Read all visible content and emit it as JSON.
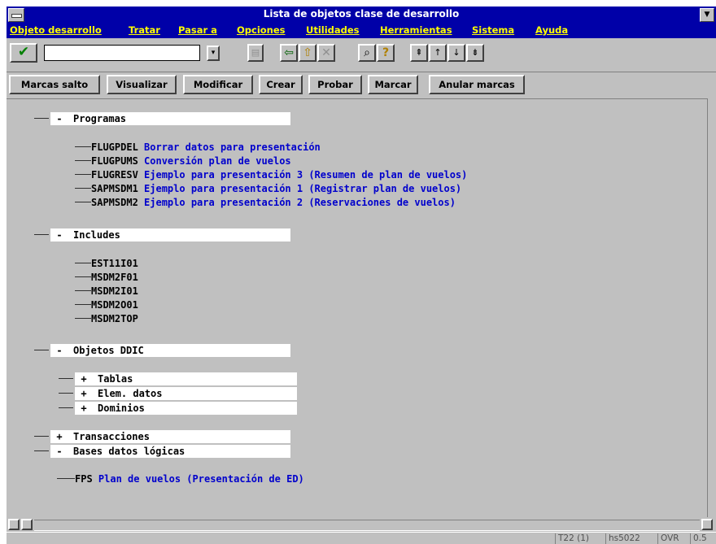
{
  "window": {
    "title": "Lista de objetos clase de desarrollo"
  },
  "menu": [
    "Objeto desarrollo",
    "Tratar",
    "Pasar a",
    "Opciones",
    "Utilidades",
    "Herramientas",
    "Sistema",
    "Ayuda"
  ],
  "toolbar": {
    "command_value": ""
  },
  "app_buttons": [
    "Marcas salto",
    "Visualizar",
    "Modificar",
    "Crear",
    "Probar",
    "Marcar",
    "Anular marcas"
  ],
  "tree": {
    "programas": {
      "label": "Programas",
      "sign": "-",
      "items": [
        {
          "name": "FLUGPDEL",
          "desc": "Borrar datos para presentación"
        },
        {
          "name": "FLUGPUMS",
          "desc": "Conversión plan de vuelos"
        },
        {
          "name": "FLUGRESV",
          "desc": "Ejemplo para presentación 3 (Resumen de plan de vuelos)"
        },
        {
          "name": "SAPMSDM1",
          "desc": "Ejemplo para presentación 1 (Registrar plan de vuelos)"
        },
        {
          "name": "SAPMSDM2",
          "desc": "Ejemplo para presentación 2 (Reservaciones de vuelos)"
        }
      ]
    },
    "includes": {
      "label": "Includes",
      "sign": "-",
      "items": [
        "EST11I01",
        "MSDM2F01",
        "MSDM2I01",
        "MSDM2O01",
        "MSDM2TOP"
      ]
    },
    "ddic": {
      "label": "Objetos DDIC",
      "sign": "-",
      "children": [
        {
          "label": "Tablas",
          "sign": "+"
        },
        {
          "label": "Elem. datos",
          "sign": "+"
        },
        {
          "label": "Dominios",
          "sign": "+"
        }
      ]
    },
    "transacciones": {
      "label": "Transacciones",
      "sign": "+"
    },
    "ldb": {
      "label": "Bases datos lógicas",
      "sign": "-",
      "items": [
        {
          "name": "FPS",
          "desc": "Plan de vuelos (Presentación de ED)"
        }
      ]
    }
  },
  "status": [
    "T22 (1)",
    "hs5022",
    "OVR",
    "0.5"
  ]
}
